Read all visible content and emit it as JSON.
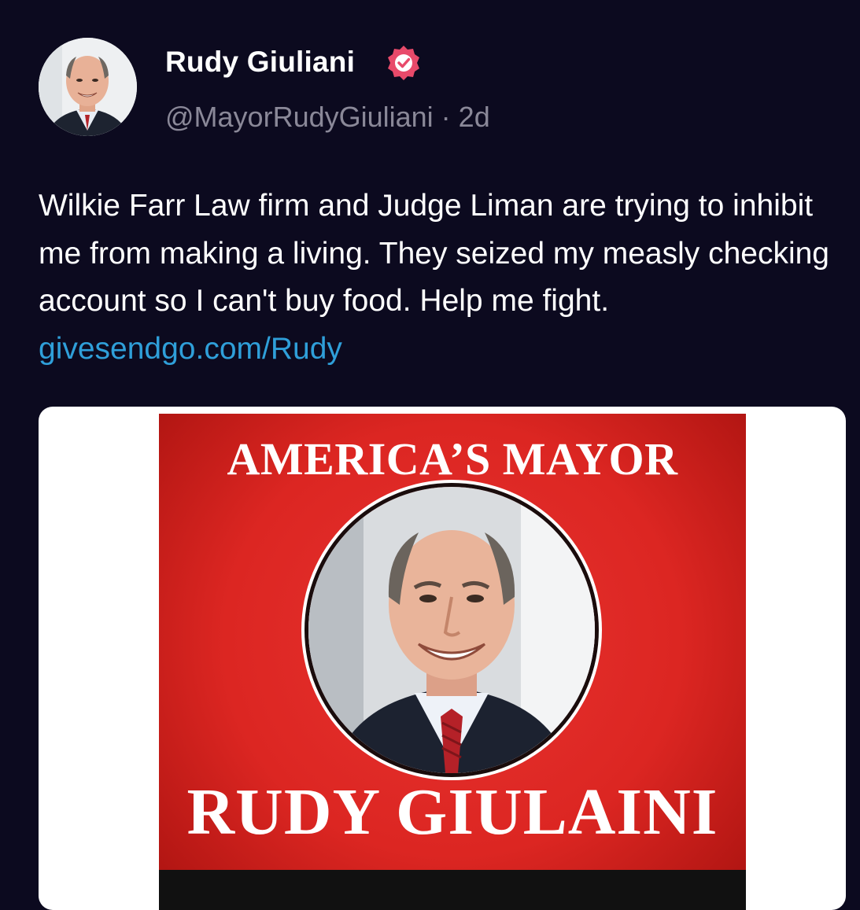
{
  "post": {
    "author": {
      "name": "Rudy Giuliani",
      "handle": "@MayorRudyGiuliani",
      "verified": true,
      "avatar_icon": "profile-photo"
    },
    "separator": " · ",
    "time_ago": "2d",
    "text": "Wilkie Farr Law firm and Judge Liman are trying to inhibit me from making a living. They seized my measly checking account so I can't buy food. Help me fight.",
    "text_gap": "       ",
    "link_text": "givesendgo.com/Rudy",
    "media": {
      "headline_top": "AMERICA’S MAYOR",
      "headline_bottom": "RUDY GIULAINI"
    }
  },
  "colors": {
    "background": "#0c0a1f",
    "link": "#2f9fd9",
    "handle": "#8a8898",
    "verified_badge": "#e84a6a",
    "poster_red": "#dc2622"
  }
}
